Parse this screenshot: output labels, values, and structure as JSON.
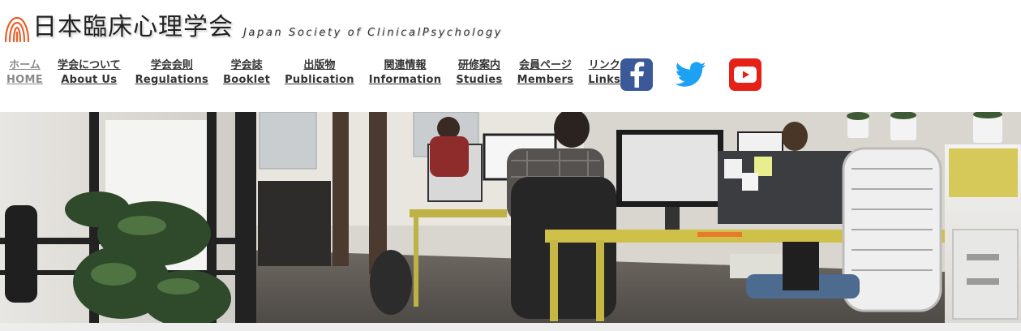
{
  "site": {
    "title": "日本臨床心理学会",
    "subtitle": "Japan Society of ClinicalPsychology"
  },
  "nav": [
    {
      "jp": "ホーム",
      "en": "HOME",
      "active": true
    },
    {
      "jp": "学会について",
      "en": "About Us"
    },
    {
      "jp": "学会会則",
      "en": "Regulations"
    },
    {
      "jp": "学会誌",
      "en": "Booklet"
    },
    {
      "jp": "出版物",
      "en": "Publication"
    },
    {
      "jp": "関連情報",
      "en": "Information"
    },
    {
      "jp": "研修案内",
      "en": "Studies"
    },
    {
      "jp": "会員ページ",
      "en": "Members"
    },
    {
      "jp": "リンク",
      "en": "Links"
    }
  ],
  "social": [
    {
      "icon": "facebook-icon",
      "color": "#3b5998"
    },
    {
      "icon": "twitter-icon",
      "color": "#1da1f2"
    },
    {
      "icon": "youtube-icon",
      "color": "#e62117"
    }
  ],
  "colors": {
    "logo_accent": "#e8612c",
    "nav_text": "#333333",
    "nav_active": "#8a8a8a"
  },
  "hero": {
    "subject": "office-workspace-photo"
  }
}
